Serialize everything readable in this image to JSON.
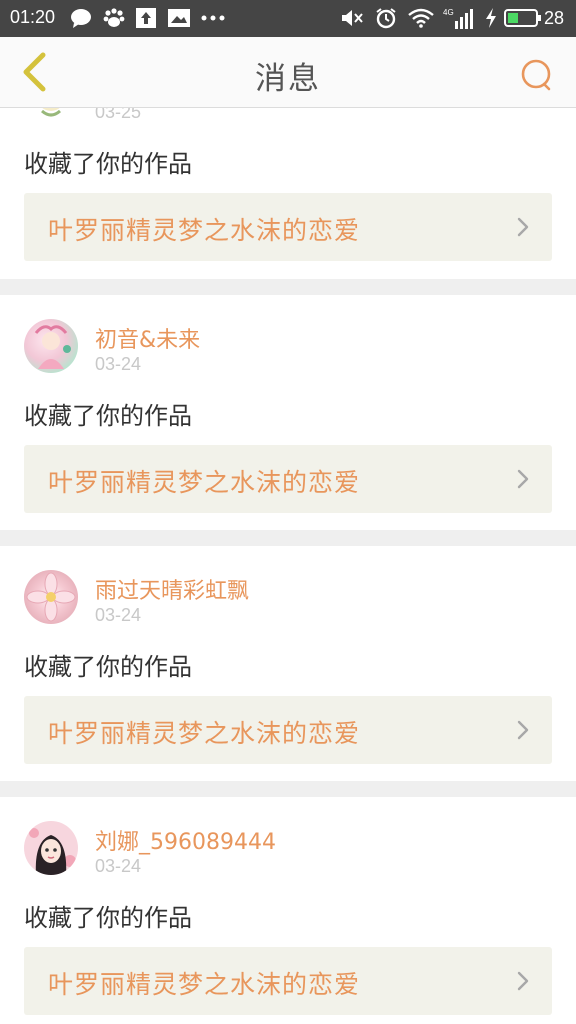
{
  "status_bar": {
    "time": "01:20",
    "battery": "28",
    "icons": [
      "chat-bubble-icon",
      "baidu-paw-icon",
      "upload-icon",
      "image-notice-icon",
      "more-dots-icon",
      "mute-icon",
      "alarm-icon",
      "wifi-icon",
      "signal-4g-icon",
      "charging-icon",
      "battery-icon"
    ]
  },
  "header": {
    "title": "消息",
    "back_icon": "chevron-left-icon",
    "search_icon": "search-icon",
    "accent": "#e8965c",
    "back_color": "#d4c23c"
  },
  "messages": [
    {
      "username": "",
      "date": "03-25",
      "action": "收藏了你的作品",
      "work_title": "叶罗丽精灵梦之水沫的恋爱"
    },
    {
      "username": "初音&未来",
      "date": "03-24",
      "action": "收藏了你的作品",
      "work_title": "叶罗丽精灵梦之水沫的恋爱"
    },
    {
      "username": "雨过天晴彩虹飘",
      "date": "03-24",
      "action": "收藏了你的作品",
      "work_title": "叶罗丽精灵梦之水沫的恋爱"
    },
    {
      "username": "刘娜_596089444",
      "date": "03-24",
      "action": "收藏了你的作品",
      "work_title": "叶罗丽精灵梦之水沫的恋爱"
    }
  ]
}
